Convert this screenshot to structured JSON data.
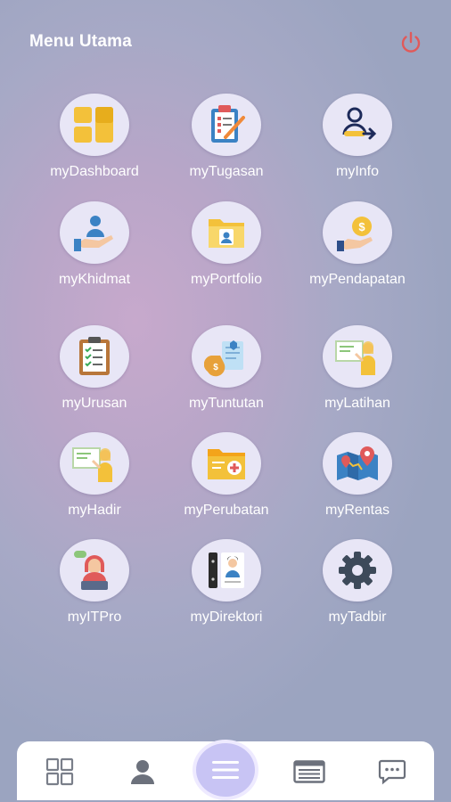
{
  "header": {
    "title": "Menu Utama",
    "power_icon": "power-icon"
  },
  "menu": {
    "items": [
      {
        "label": "myDashboard",
        "icon": "dashboard-icon"
      },
      {
        "label": "myTugasan",
        "icon": "task-clipboard-icon"
      },
      {
        "label": "myInfo",
        "icon": "user-info-icon"
      },
      {
        "label": "myKhidmat",
        "icon": "service-hand-icon"
      },
      {
        "label": "myPortfolio",
        "icon": "portfolio-folder-icon"
      },
      {
        "label": "myPendapatan",
        "icon": "income-coin-icon"
      },
      {
        "label": "myUrusan",
        "icon": "checklist-icon"
      },
      {
        "label": "myTuntutan",
        "icon": "claim-moneybag-icon"
      },
      {
        "label": "myLatihan",
        "icon": "training-presenter-icon"
      },
      {
        "label": "myHadir",
        "icon": "attendance-presenter-icon"
      },
      {
        "label": "myPerubatan",
        "icon": "medical-folder-icon"
      },
      {
        "label": "myRentas",
        "icon": "map-pin-icon"
      },
      {
        "label": "myITPro",
        "icon": "it-support-icon"
      },
      {
        "label": "myDirektori",
        "icon": "directory-id-icon"
      },
      {
        "label": "myTadbir",
        "icon": "gear-icon"
      }
    ]
  },
  "bottom_nav": {
    "items": [
      "grid-icon",
      "profile-icon",
      "menu-icon",
      "list-card-icon",
      "chat-icon"
    ],
    "active": "menu-icon",
    "accent": "#c8c4f4"
  }
}
